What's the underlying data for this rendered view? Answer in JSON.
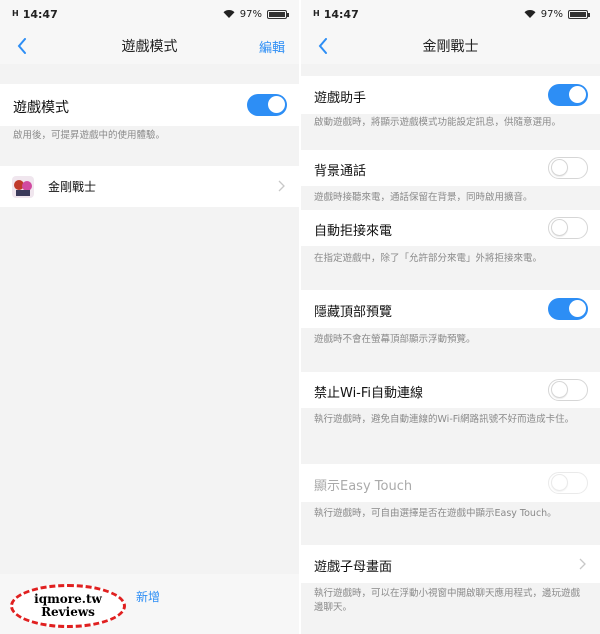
{
  "left": {
    "status": {
      "signal": "H",
      "time": "14:47",
      "battery": "97%"
    },
    "nav": {
      "title": "遊戲模式",
      "action": "編輯"
    },
    "mode": {
      "label": "遊戲模式",
      "desc": "啟用後，可提昇遊戲中的使用體驗。",
      "toggle": "on"
    },
    "games": [
      {
        "name": "金剛戰士"
      }
    ],
    "bottom": {
      "add_label": "新增",
      "watermark_line1": "iqmore.tw",
      "watermark_line2": "Reviews"
    }
  },
  "right": {
    "status": {
      "signal": "H",
      "time": "14:47",
      "battery": "97%"
    },
    "nav": {
      "title": "金剛戰士"
    },
    "settings": [
      {
        "label": "遊戲助手",
        "desc": "啟動遊戲時，將顯示遊戲模式功能設定訊息，供隨意選用。",
        "toggle": "on"
      },
      {
        "label": "背景通話",
        "desc": "遊戲時接聽來電，通話保留在背景，同時啟用擴音。",
        "toggle": "off"
      },
      {
        "label": "自動拒接來電",
        "desc": "在指定遊戲中，除了「允許部分來電」外將拒接來電。",
        "toggle": "off"
      },
      {
        "label": "隱藏頂部預覽",
        "desc": "遊戲時不會在螢幕頂部顯示浮動預覽。",
        "toggle": "on"
      },
      {
        "label": "禁止Wi-Fi自動連線",
        "desc": "執行遊戲時，避免自動連線的Wi-Fi網路訊號不好而造成卡住。",
        "toggle": "off"
      },
      {
        "label": "顯示Easy Touch",
        "desc": "執行遊戲時，可自由選擇是否在遊戲中顯示Easy Touch。",
        "toggle": "disabled"
      },
      {
        "label": "遊戲子母畫面",
        "desc": "執行遊戲時，可以在浮動小視窗中開啟聊天應用程式，邊玩遊戲邊聊天。"
      }
    ]
  },
  "colors": {
    "accent": "#2d8ef5",
    "toggle_off": "#ffffff",
    "background": "#f3f3f3",
    "card": "#ffffff"
  },
  "icons": [
    "back-arrow-icon",
    "wifi-icon",
    "battery-icon",
    "chevron-right-icon",
    "game-icon"
  ]
}
